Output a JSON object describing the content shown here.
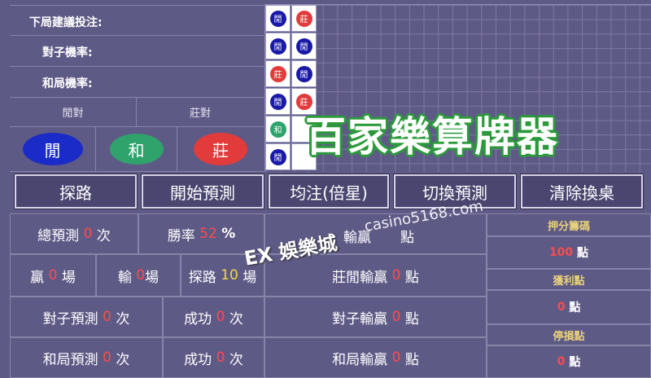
{
  "left_panel": {
    "next_bet_label": "下局建議投注:",
    "pair_rate_label": "對子機率:",
    "tie_rate_label": "和局機率:",
    "player_pair_label": "閒對",
    "banker_pair_label": "莊對",
    "player_button": "閒",
    "tie_button": "和",
    "banker_button": "莊"
  },
  "road": {
    "cells": [
      {
        "text": "閒",
        "color": "#1a1aa8"
      },
      {
        "text": "莊",
        "color": "#e23b3b"
      },
      {
        "text": "閒",
        "color": "#1a1aa8"
      },
      {
        "text": "閒",
        "color": "#1a1aa8"
      },
      {
        "text": "莊",
        "color": "#e23b3b"
      },
      {
        "text": "閒",
        "color": "#1a1aa8"
      },
      {
        "text": "閒",
        "color": "#1a1aa8"
      },
      {
        "text": "莊",
        "color": "#e23b3b"
      },
      {
        "text": "和",
        "color": "#2fa36b"
      },
      {
        "text": "",
        "color": ""
      },
      {
        "text": "閒",
        "color": "#1a1aa8"
      },
      {
        "text": "",
        "color": ""
      }
    ]
  },
  "overlay_title": "百家樂算牌器",
  "toolbar": {
    "road_label": "探路",
    "start_label": "開始預測",
    "flat_label": "均注(倍星)",
    "switch_label": "切換預測",
    "clear_label": "清除換桌"
  },
  "stats": {
    "total_label": "總預測",
    "total_value": "0",
    "total_unit": "次",
    "winrate_label": "勝率",
    "winrate_value": "52",
    "winrate_unit": "%",
    "win_label": "贏",
    "win_value": "0",
    "win_unit": "場",
    "lose_label": "輸",
    "lose_value": "0",
    "lose_unit": "場",
    "road_label": "探路",
    "road_value": "10",
    "road_unit": "場",
    "bp_label": "莊閒輸贏",
    "bp_value": "0",
    "bp_unit": "點",
    "pair_pred_label": "對子預測",
    "pair_pred_value": "0",
    "pair_pred_unit": "次",
    "pair_succ_label": "成功",
    "pair_succ_value": "0",
    "pair_succ_unit": "次",
    "pair_wl_label": "對子輸贏",
    "pair_wl_value": "0",
    "pair_wl_unit": "點",
    "tie_pred_label": "和局預測",
    "tie_pred_value": "0",
    "tie_pred_unit": "次",
    "tie_succ_label": "成功",
    "tie_succ_value": "0",
    "tie_succ_unit": "次",
    "tie_wl_label": "和局輸贏",
    "tie_wl_value": "0",
    "tie_wl_unit": "點",
    "top_partial_label": "輸贏",
    "top_partial_unit": "點"
  },
  "right_panel": {
    "bet_chips_label": "押分籌碼",
    "bet_value": "100",
    "bet_unit": "點",
    "profit_label": "獲利點",
    "profit_value": "0",
    "profit_unit": "點",
    "stop_label": "停損點",
    "stop_value": "0",
    "stop_unit": "點"
  },
  "watermark": {
    "url": "casino5168.com",
    "brand": "EX 娛樂城"
  }
}
